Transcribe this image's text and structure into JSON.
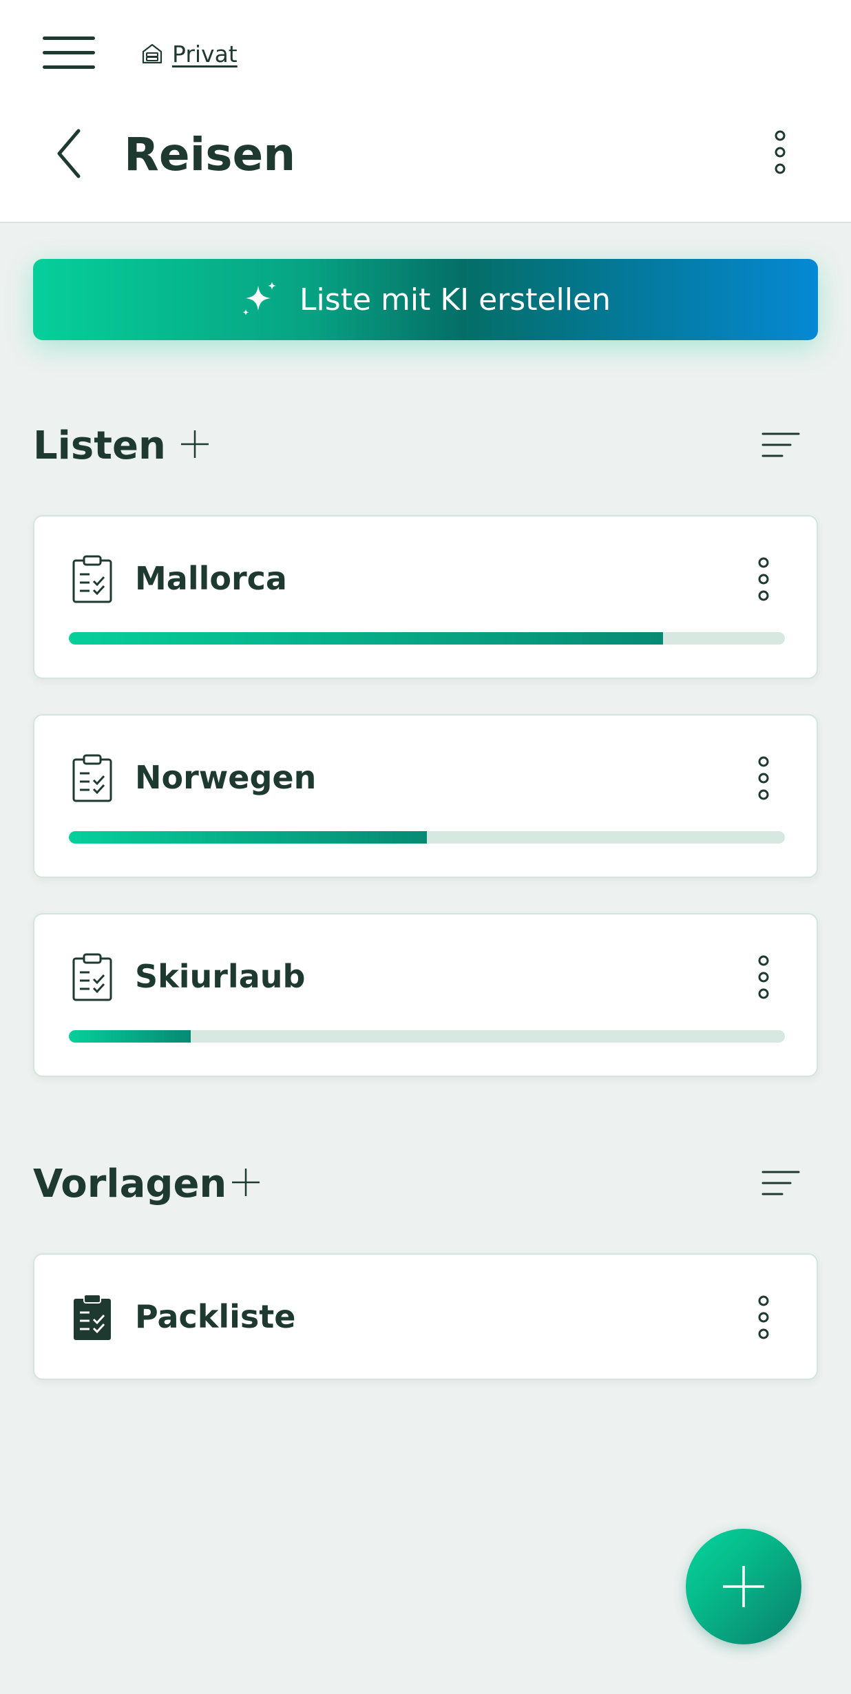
{
  "header": {
    "breadcrumb": "Privat",
    "title": "Reisen"
  },
  "ai_button": {
    "label": "Liste mit KI erstellen"
  },
  "sections": {
    "lists": {
      "title": "Listen",
      "items": [
        {
          "name": "Mallorca",
          "progress": 0.83
        },
        {
          "name": "Norwegen",
          "progress": 0.5
        },
        {
          "name": "Skiurlaub",
          "progress": 0.17
        }
      ]
    },
    "templates": {
      "title": "Vorlagen",
      "items": [
        {
          "name": "Packliste"
        }
      ]
    }
  },
  "colors": {
    "primary_dark": "#1e3a30",
    "accent": "#06cf9a",
    "accent_dark": "#078a74",
    "ai_gradient_end": "#0689d3",
    "background": "#edf1ef",
    "progress_track": "#d6e8df"
  },
  "icons": {
    "menu": "hamburger-menu-icon",
    "breadcrumb": "house-icon",
    "back": "chevron-left-icon",
    "more": "vertical-dots-icon",
    "ai": "sparkle-icon",
    "add": "plus-icon",
    "sort": "sort-lines-icon",
    "list": "clipboard-checklist-icon",
    "template": "clipboard-filled-icon",
    "fab": "plus-icon"
  }
}
